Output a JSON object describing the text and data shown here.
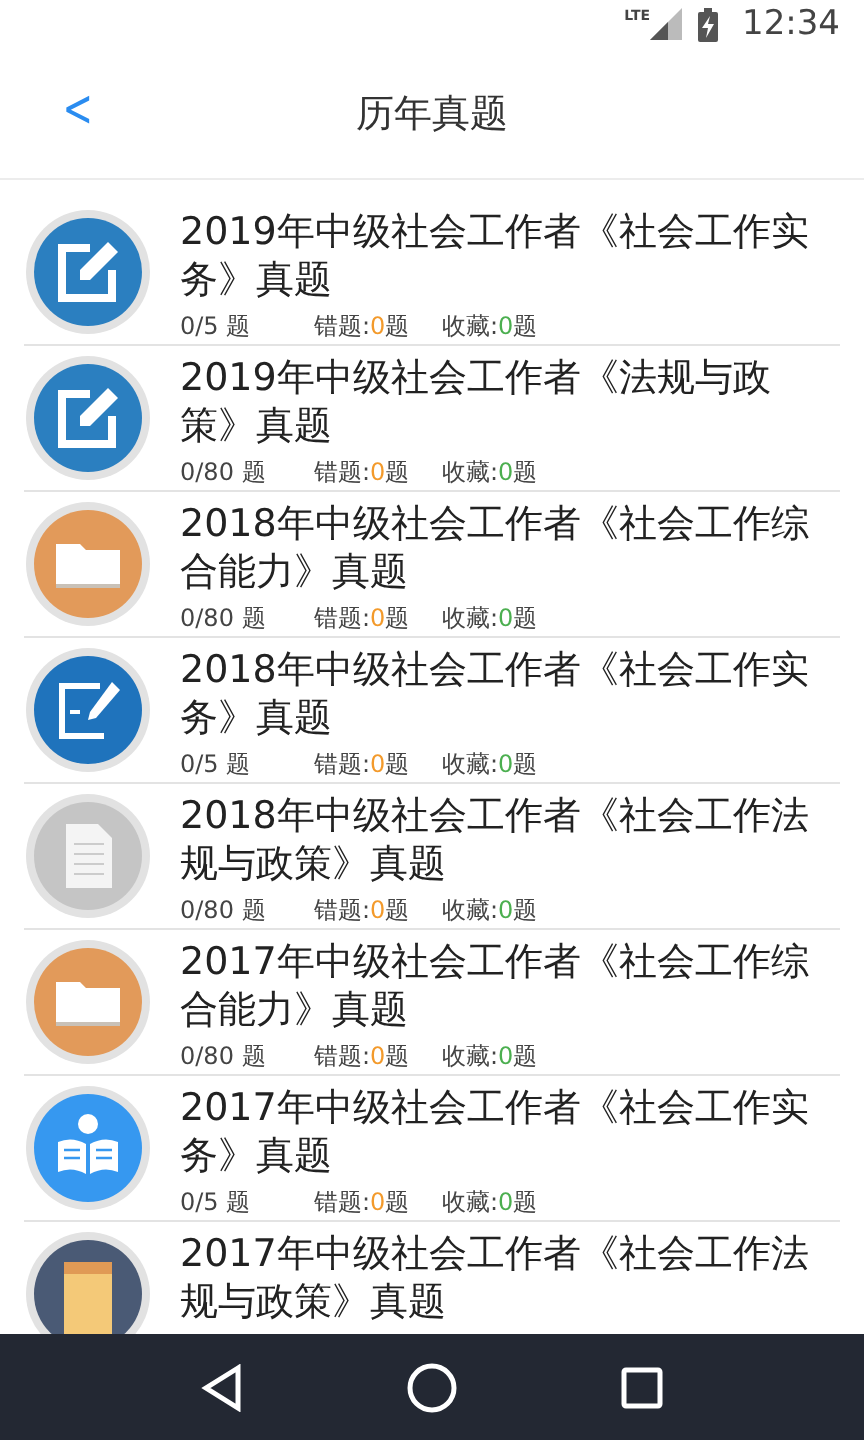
{
  "status_bar": {
    "network": "LTE",
    "time": "12:34"
  },
  "header": {
    "back": "<",
    "title": "历年真题"
  },
  "items": [
    {
      "kind": "edit",
      "title": "2019年中级社会工作者《社会工作实务》真题",
      "progress": "0/5 题",
      "wrong": {
        "label": "错题:",
        "value": "0",
        "unit": "题"
      },
      "favorites": {
        "label": "收藏:",
        "value": "0",
        "unit": "题"
      }
    },
    {
      "kind": "edit",
      "title": "2019年中级社会工作者《法规与政策》真题",
      "progress": "0/80 题",
      "wrong": {
        "label": "错题:",
        "value": "0",
        "unit": "题"
      },
      "favorites": {
        "label": "收藏:",
        "value": "0",
        "unit": "题"
      }
    },
    {
      "kind": "folder",
      "title": "2018年中级社会工作者《社会工作综合能力》真题",
      "progress": "0/80 题",
      "wrong": {
        "label": "错题:",
        "value": "0",
        "unit": "题"
      },
      "favorites": {
        "label": "收藏:",
        "value": "0",
        "unit": "题"
      }
    },
    {
      "kind": "sign",
      "title": "2018年中级社会工作者《社会工作实务》真题",
      "progress": "0/5 题",
      "wrong": {
        "label": "错题:",
        "value": "0",
        "unit": "题"
      },
      "favorites": {
        "label": "收藏:",
        "value": "0",
        "unit": "题"
      }
    },
    {
      "kind": "document",
      "title": "2018年中级社会工作者《社会工作法规与政策》真题",
      "progress": "0/80 题",
      "wrong": {
        "label": "错题:",
        "value": "0",
        "unit": "题"
      },
      "favorites": {
        "label": "收藏:",
        "value": "0",
        "unit": "题"
      }
    },
    {
      "kind": "folder",
      "title": "2017年中级社会工作者《社会工作综合能力》真题",
      "progress": "0/80 题",
      "wrong": {
        "label": "错题:",
        "value": "0",
        "unit": "题"
      },
      "favorites": {
        "label": "收藏:",
        "value": "0",
        "unit": "题"
      }
    },
    {
      "kind": "reader",
      "title": "2017年中级社会工作者《社会工作实务》真题",
      "progress": "0/5 题",
      "wrong": {
        "label": "错题:",
        "value": "0",
        "unit": "题"
      },
      "favorites": {
        "label": "收藏:",
        "value": "0",
        "unit": "题"
      }
    },
    {
      "kind": "box",
      "title": "2017年中级社会工作者《社会工作法规与政策》真题"
    }
  ]
}
